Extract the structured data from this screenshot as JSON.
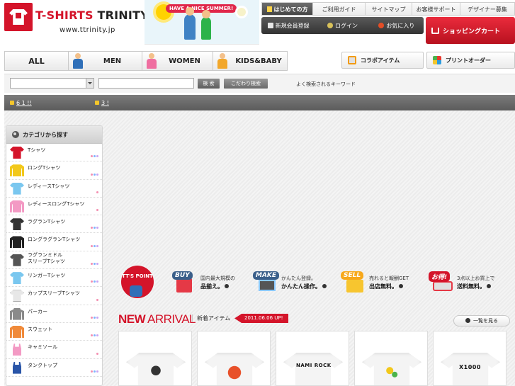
{
  "header": {
    "logo_name_red": "T-SHIRTS",
    "logo_name_black": "TRINITY",
    "logo_url": "www.ttrinity.jp",
    "banner_tag": "HAVE A NICE SUMMER!",
    "util_nav": [
      "はじめての方",
      "ご利用ガイド",
      "サイトマップ",
      "お客様サポート",
      "デザイナー募集"
    ],
    "user_nav": [
      "新規会員登録",
      "ログイン",
      "お気に入り"
    ],
    "cart_label": "ショッピングカート"
  },
  "tabs": {
    "all": "ALL",
    "men": "MEN",
    "women": "WOMEN",
    "kids": "KIDS&BABY",
    "collab": "コラボアイテム",
    "print_order": "プリントオーダー"
  },
  "search": {
    "select_value": "",
    "keyword_value": "",
    "search_button": "検 索",
    "advanced_button": "こだわり検索",
    "popular_label": "よく検索されるキーワード"
  },
  "news": [
    {
      "text": "6 1 !!"
    },
    {
      "text": "3 !"
    }
  ],
  "sidebar": {
    "title": "カテゴリから探す",
    "items": [
      {
        "label": "Tシャツ",
        "shape": "tee",
        "color": "#d4142a",
        "dots": [
          "#f48fb1",
          "#7fb2ff",
          "#c9a4f2"
        ]
      },
      {
        "label": "ロングTシャツ",
        "shape": "long",
        "color": "#f2c81b",
        "dots": [
          "#f48fb1",
          "#7fb2ff",
          "#c9a4f2"
        ]
      },
      {
        "label": "レディースTシャツ",
        "shape": "tee",
        "color": "#7ac7ef",
        "dots": [
          "#f48fb1"
        ]
      },
      {
        "label": "レディースロングTシャツ",
        "shape": "long",
        "color": "#f39ac4",
        "dots": [
          "#f48fb1"
        ]
      },
      {
        "label": "ラグランTシャツ",
        "shape": "tee",
        "color": "#333333",
        "dots": [
          "#f48fb1",
          "#7fb2ff",
          "#c9a4f2"
        ]
      },
      {
        "label": "ロングラグランTシャツ",
        "shape": "long",
        "color": "#222222",
        "dots": [
          "#f48fb1",
          "#7fb2ff",
          "#c9a4f2"
        ]
      },
      {
        "label": "ラグランミドル\nスリーブTシャツ",
        "shape": "tee",
        "color": "#555555",
        "dots": [
          "#f48fb1",
          "#7fb2ff",
          "#c9a4f2"
        ]
      },
      {
        "label": "リンガーTシャツ",
        "shape": "tee",
        "color": "#7ac7ef",
        "dots": [
          "#f48fb1",
          "#7fb2ff",
          "#c9a4f2"
        ]
      },
      {
        "label": "カップスリーブTシャツ",
        "shape": "tee",
        "color": "#e7e7e7",
        "dots": [
          "#f48fb1"
        ]
      },
      {
        "label": "パーカー",
        "shape": "hood",
        "color": "#8a8a8a",
        "dots": [
          "#f48fb1",
          "#7fb2ff",
          "#c9a4f2"
        ]
      },
      {
        "label": "スウェット",
        "shape": "long",
        "color": "#f08a3a",
        "dots": [
          "#f48fb1",
          "#7fb2ff",
          "#c9a4f2"
        ]
      },
      {
        "label": "キャミソール",
        "shape": "cami",
        "color": "#f39ac4",
        "dots": [
          "#f48fb1"
        ]
      },
      {
        "label": "タンクトップ",
        "shape": "cami",
        "color": "#2a55a8",
        "dots": [
          "#f48fb1",
          "#7fb2ff",
          "#c9a4f2"
        ]
      }
    ]
  },
  "points": {
    "badge": "TT'S POINT",
    "items": [
      {
        "bubble": "BUY",
        "line1": "国内最大規模の",
        "line2": "品揃え。"
      },
      {
        "bubble": "MAKE",
        "line1": "かんたん登録。",
        "line2": "かんたん操作。"
      },
      {
        "bubble": "SELL",
        "line1": "売れると報酬GET",
        "line2": "出店無料。"
      },
      {
        "bubble": "お得!",
        "line1": "3点以上お買上で",
        "line2": "送料無料。"
      }
    ]
  },
  "new_arrival": {
    "title_bold": "NEW",
    "title_light": "ARRIVAL",
    "subtitle": "新着アイテム",
    "date": "2011.06.06 UP!",
    "more": "一覧を見る",
    "products": [
      {
        "print_label": ""
      },
      {
        "print_label": ""
      },
      {
        "print_label": "NAMI ROCK"
      },
      {
        "print_label": ""
      },
      {
        "print_label": "X1000"
      }
    ]
  },
  "colors": {
    "brand_red": "#d4142a",
    "dark_bar": "#5b5b5b"
  }
}
